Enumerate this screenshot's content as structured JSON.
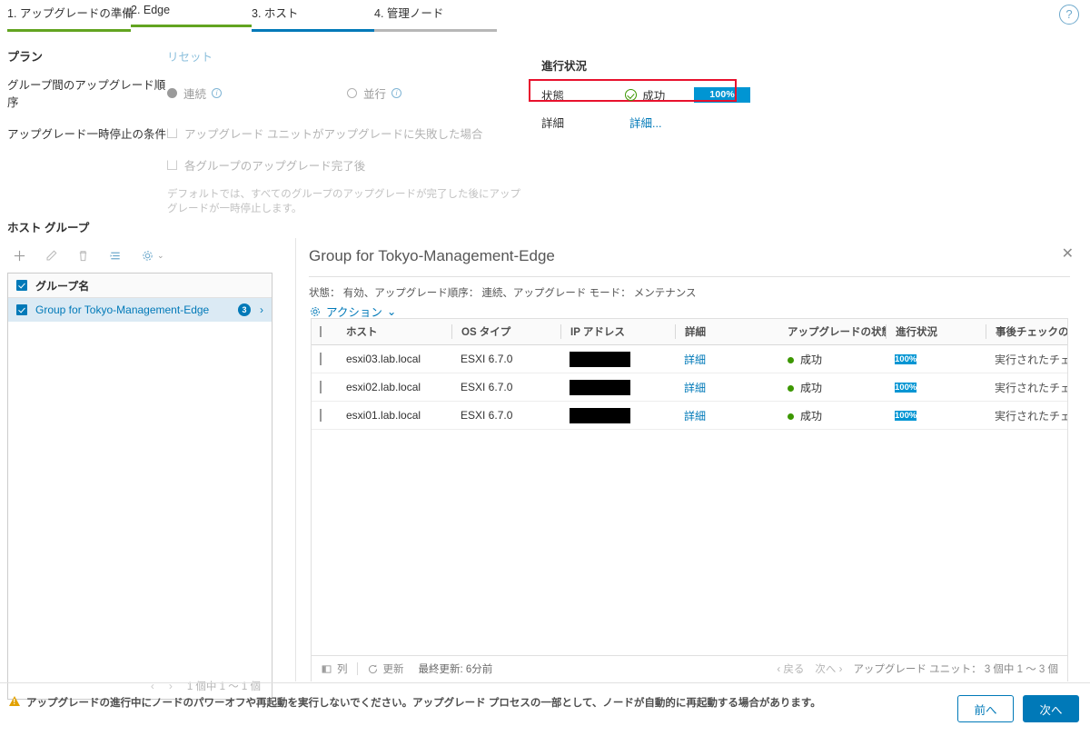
{
  "wizard": {
    "tabs": [
      {
        "label": "1. アップグレードの準備",
        "state": "done"
      },
      {
        "label": "2. Edge",
        "state": "done"
      },
      {
        "label": "3. ホスト",
        "state": "active"
      },
      {
        "label": "4. 管理ノード",
        "state": "todo"
      }
    ],
    "help_icon": "help-circle-icon",
    "help_label": "?"
  },
  "plan": {
    "title": "プラン",
    "reset_label": "リセット",
    "order_label": "グループ間のアップグレード順序",
    "order_options": [
      {
        "label": "連続",
        "selected": true
      },
      {
        "label": "並行",
        "selected": false
      }
    ],
    "pause_label": "アップグレード一時停止の条件",
    "pause_options": [
      {
        "label": "アップグレード ユニットがアップグレードに失敗した場合",
        "checked": false
      },
      {
        "label": "各グループのアップグレード完了後",
        "checked": false
      }
    ],
    "hint": "デフォルトでは、すべてのグループのアップグレードが完了した後にアップグレードが一時停止します。"
  },
  "progress": {
    "title": "進行状況",
    "status_key": "状態",
    "status_value": "成功",
    "status_percent": "100%",
    "detail_key": "詳細",
    "detail_link": "詳細...",
    "accent_color": "#0095d3",
    "success_color": "#3c9700",
    "highlight_color": "#e8112d"
  },
  "hostgroups": {
    "title": "ホスト グループ",
    "toolbar": [
      {
        "name": "add-icon",
        "glyph": "+"
      },
      {
        "name": "edit-icon",
        "glyph": "✎"
      },
      {
        "name": "delete-icon",
        "glyph": "🗑"
      },
      {
        "name": "reorder-icon",
        "glyph": "≔"
      },
      {
        "name": "gear-icon",
        "glyph": "⚙"
      }
    ],
    "column_header": "グループ名",
    "rows": [
      {
        "name": "Group for Tokyo-Management-Edge",
        "count": "3",
        "checked": true
      }
    ],
    "pager": {
      "prev": "‹",
      "next": "›",
      "count": "1 個中 1 〜 1 個"
    }
  },
  "detail": {
    "title": "Group for Tokyo-Management-Edge",
    "close_label": "✕",
    "subtitle": "状態： 有効、アップグレード順序： 連続、アップグレード モード： メンテナンス",
    "actions_label": "アクション",
    "actions_caret": "⌄",
    "columns": [
      "ホスト",
      "OS タイプ",
      "IP アドレス",
      "詳細",
      "アップグレードの状態",
      "進行状況",
      "事後チェックの状態"
    ],
    "rows": [
      {
        "host": "esxi03.lab.local",
        "os": "ESXI 6.7.0",
        "ip": "",
        "detail": "詳細",
        "upgrade_status": "成功",
        "progress": "100%",
        "postcheck": "実行されたチェッ…"
      },
      {
        "host": "esxi02.lab.local",
        "os": "ESXI 6.7.0",
        "ip": "",
        "detail": "詳細",
        "upgrade_status": "成功",
        "progress": "100%",
        "postcheck": "実行されたチェッ…"
      },
      {
        "host": "esxi01.lab.local",
        "os": "ESXI 6.7.0",
        "ip": "",
        "detail": "詳細",
        "upgrade_status": "成功",
        "progress": "100%",
        "postcheck": "実行されたチェッ…"
      }
    ],
    "footer": {
      "columns_label": "列",
      "refresh_label": "更新",
      "last_updated": "最終更新: 6分前",
      "prev_label": "戻る",
      "next_label": "次へ",
      "count": "アップグレード ユニット： 3 個中 1 〜 3 個"
    }
  },
  "bottom": {
    "warning": "アップグレードの進行中にノードのパワーオフや再起動を実行しないでください。アップグレード プロセスの一部として、ノードが自動的に再起動する場合があります。",
    "back_label": "前へ",
    "next_label": "次へ"
  }
}
